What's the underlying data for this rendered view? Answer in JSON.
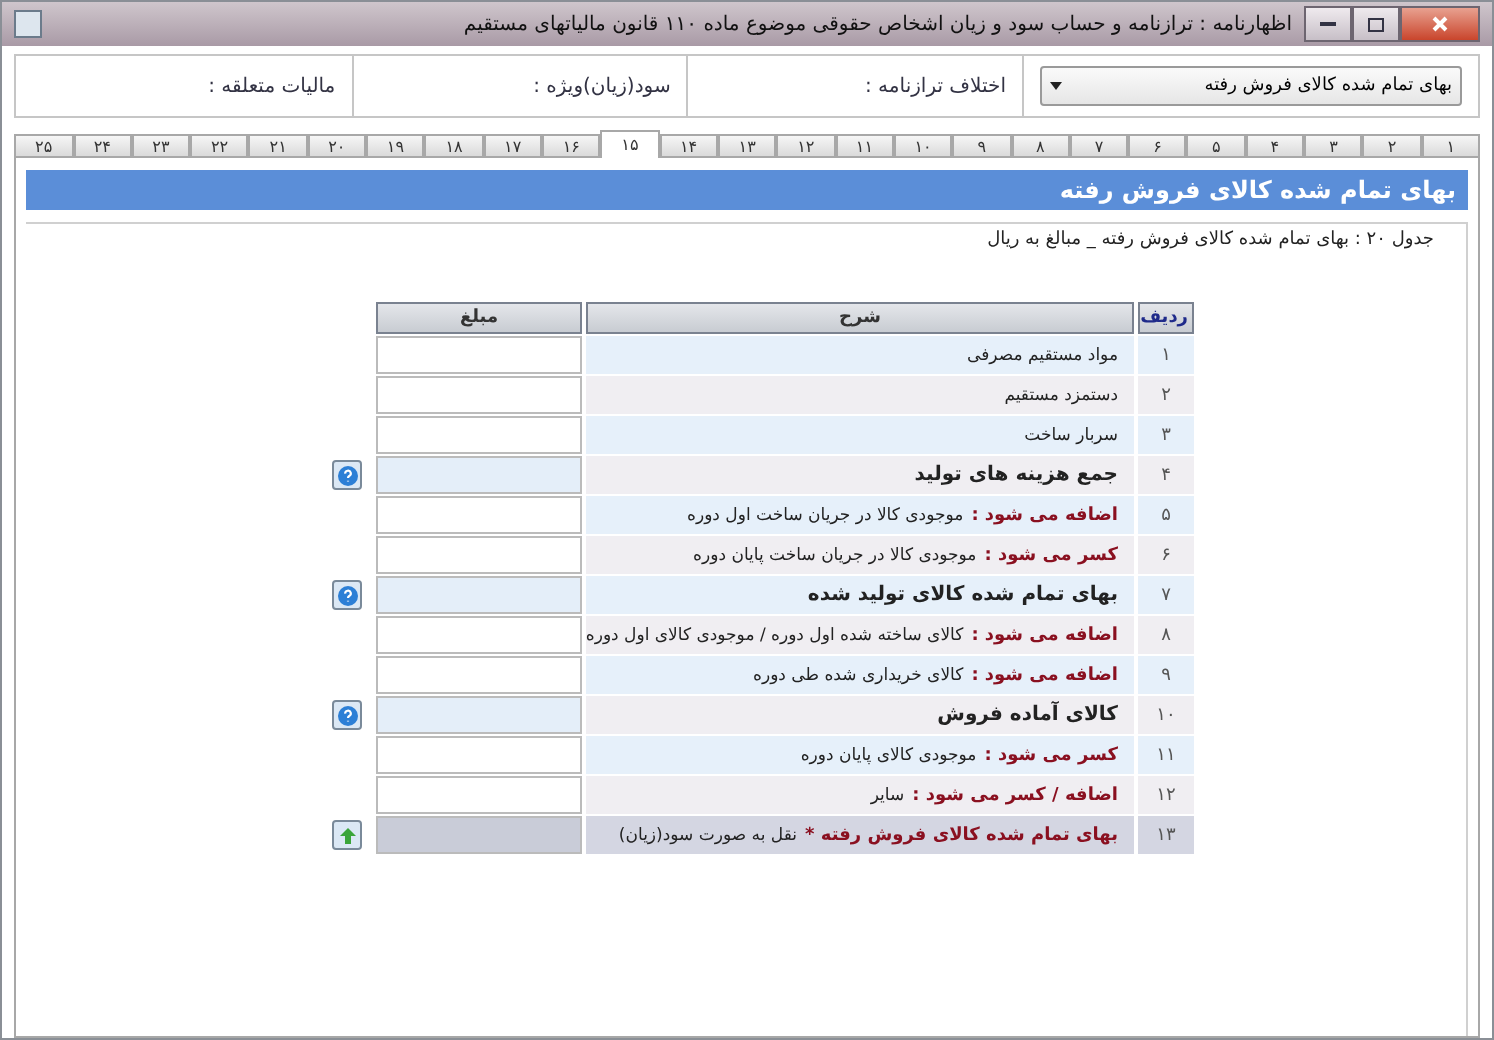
{
  "window": {
    "title": "اظهارنامه : ترازنامه و حساب سود و زیان اشخاص حقوقی موضوع ماده ۱۱۰ قانون مالیاتهای مستقیم"
  },
  "summary": {
    "dropdown": {
      "value": "بهای تمام شده کالای فروش رفته"
    },
    "fields": [
      {
        "label": "اختلاف ترازنامه :"
      },
      {
        "label": "سود(زیان)ویژه :"
      },
      {
        "label": "مالیات متعلقه :"
      }
    ]
  },
  "tabs": [
    {
      "label": "۱",
      "selected": false
    },
    {
      "label": "۲",
      "selected": false
    },
    {
      "label": "۳",
      "selected": false
    },
    {
      "label": "۴",
      "selected": false
    },
    {
      "label": "۵",
      "selected": false
    },
    {
      "label": "۶",
      "selected": false
    },
    {
      "label": "۷",
      "selected": false
    },
    {
      "label": "۸",
      "selected": false
    },
    {
      "label": "۹",
      "selected": false
    },
    {
      "label": "۱۰",
      "selected": false
    },
    {
      "label": "۱۱",
      "selected": false
    },
    {
      "label": "۱۲",
      "selected": false
    },
    {
      "label": "۱۳",
      "selected": false
    },
    {
      "label": "۱۴",
      "selected": false
    },
    {
      "label": "۱۵",
      "selected": true
    },
    {
      "label": "۱۶",
      "selected": false
    },
    {
      "label": "۱۷",
      "selected": false
    },
    {
      "label": "۱۸",
      "selected": false
    },
    {
      "label": "۱۹",
      "selected": false
    },
    {
      "label": "۲۰",
      "selected": false
    },
    {
      "label": "۲۱",
      "selected": false
    },
    {
      "label": "۲۲",
      "selected": false
    },
    {
      "label": "۲۳",
      "selected": false
    },
    {
      "label": "۲۴",
      "selected": false
    },
    {
      "label": "۲۵",
      "selected": false
    }
  ],
  "section": {
    "title": "بهای تمام شده کالای فروش رفته",
    "caption": "جدول ۲۰ : بهای تمام شده کالای فروش رفته _ مبالغ به ریال"
  },
  "table": {
    "columns": [
      "ردیف",
      "شرح",
      "مبلغ"
    ],
    "rows": [
      {
        "number": "۱",
        "kind": "item",
        "text": "مواد مستقیم مصرفی"
      },
      {
        "number": "۲",
        "kind": "item",
        "text": "دستمزد مستقیم"
      },
      {
        "number": "۳",
        "kind": "item",
        "text": "سربار ساخت"
      },
      {
        "number": "۴",
        "kind": "total",
        "text": "جمع هزینه های تولید"
      },
      {
        "number": "۵",
        "kind": "adjust",
        "prefix": "اضافه می شود :",
        "text": "موجودی کالا در جریان ساخت اول دوره"
      },
      {
        "number": "۶",
        "kind": "adjust",
        "prefix": "کسر می شود :",
        "text": "موجودی کالا در جریان ساخت پایان دوره"
      },
      {
        "number": "۷",
        "kind": "total",
        "text": "بهای تمام شده کالای تولید شده"
      },
      {
        "number": "۸",
        "kind": "adjust",
        "prefix": "اضافه می شود :",
        "text": "کالای ساخته شده اول دوره / موجودی کالای اول دوره"
      },
      {
        "number": "۹",
        "kind": "adjust",
        "prefix": "اضافه می شود :",
        "text": "کالای خریداری شده طی دوره"
      },
      {
        "number": "۱۰",
        "kind": "total",
        "text": "کالای آماده فروش"
      },
      {
        "number": "۱۱",
        "kind": "adjust",
        "prefix": "کسر می شود :",
        "text": "موجودی کالای پایان دوره"
      },
      {
        "number": "۱۲",
        "kind": "adjust",
        "prefix": "اضافه / کسر می شود :",
        "text": "سایر"
      },
      {
        "number": "۱۳",
        "kind": "final",
        "prefix": "بهای تمام شده کالای فروش رفته *",
        "text": "نقل به صورت سود(زیان)"
      }
    ]
  }
}
